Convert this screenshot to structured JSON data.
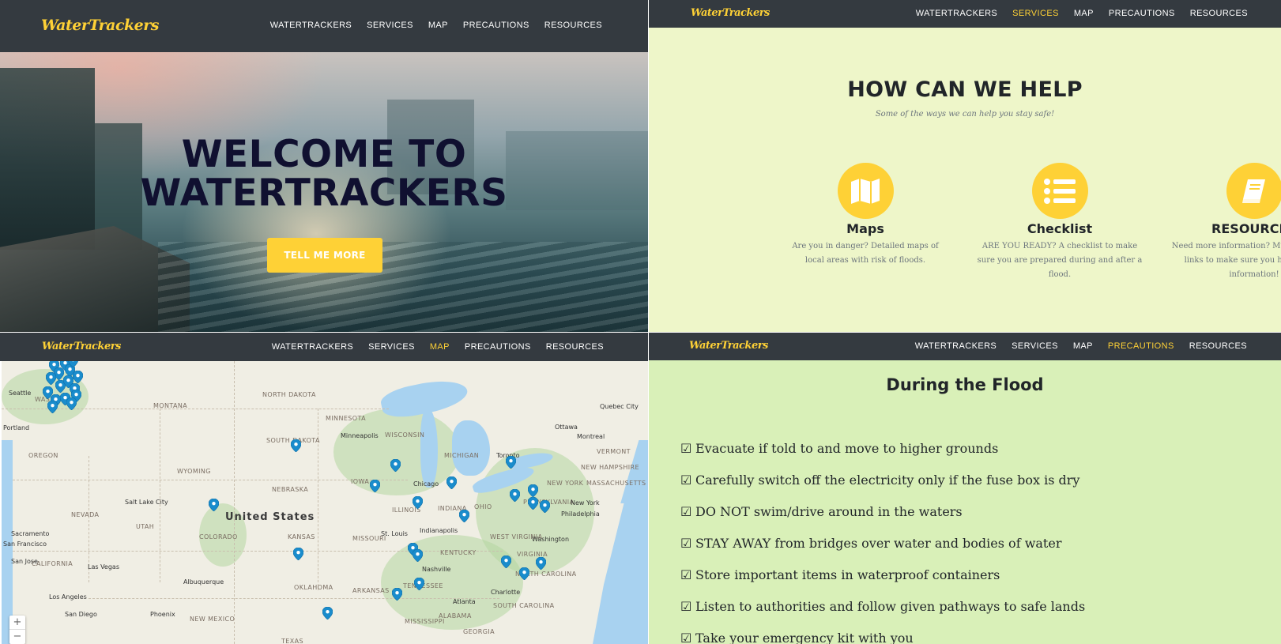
{
  "brand": "WaterTrackers",
  "nav_links": [
    "WATERTRACKERS",
    "SERVICES",
    "MAP",
    "PRECAUTIONS",
    "RESOURCES"
  ],
  "accent_color": "#fed136",
  "nav_color": "#343a40",
  "hero": {
    "title_line1": "WELCOME TO",
    "title_line2": "WATERTRACKERS",
    "button": "TELL ME MORE"
  },
  "services": {
    "active_nav": "SERVICES",
    "title": "HOW CAN WE HELP",
    "subtitle": "Some of the ways we can help you stay safe!",
    "items": [
      {
        "icon": "map-icon",
        "title": "Maps",
        "text": "Are you in danger? Detailed maps of local areas with risk of floods."
      },
      {
        "icon": "list-icon",
        "title": "Checklist",
        "text": "ARE YOU READY? A checklist to make sure you are prepared during and after a flood."
      },
      {
        "icon": "book-icon",
        "title": "RESOURCES",
        "text": "Need more information? Multiple helpful links to make sure you have all the information!"
      }
    ]
  },
  "map": {
    "active_nav": "MAP",
    "country": "United States",
    "zoom_in": "+",
    "zoom_out": "−",
    "states": [
      "NORTH DAKOTA",
      "MONTANA",
      "MINNESOTA",
      "SOUTH DAKOTA",
      "WISCONSIN",
      "MICHIGAN",
      "OREGON",
      "WYOMING",
      "IOWA",
      "NEBRASKA",
      "NEVADA",
      "UTAH",
      "COLORADO",
      "ILLINOIS",
      "INDIANA",
      "OHIO",
      "KANSAS",
      "MISSOURI",
      "KENTUCKY",
      "CALIFORNIA",
      "OKLAHOMA",
      "ARKANSAS",
      "TENNESSEE",
      "VIRGINIA",
      "WEST VIRGINIA",
      "NORTH CAROLINA",
      "SOUTH CAROLINA",
      "NEW MEXICO",
      "MISSISSIPPI",
      "ALABAMA",
      "GEORGIA",
      "TEXAS",
      "NEW YORK",
      "VERMONT",
      "NEW HAMPSHIRE",
      "MASSACHUSETTS",
      "PENNSYLVANIA",
      "WASH"
    ],
    "cities": [
      "Seattle",
      "Portland",
      "Minneapolis",
      "Chicago",
      "Toronto",
      "Ottawa",
      "Montreal",
      "Quebec City",
      "Salt Lake City",
      "Sacramento",
      "San Francisco",
      "San Jose",
      "Las Vegas",
      "Los Angeles",
      "San Diego",
      "Phoenix",
      "Albuquerque",
      "St. Louis",
      "Indianapolis",
      "Nashville",
      "Washington",
      "Charlotte",
      "Atlanta",
      "New York",
      "Philadelphia"
    ]
  },
  "precautions": {
    "active_nav": "PRECAUTIONS",
    "title": "During the Flood",
    "items": [
      "Evacuate if told to and move to higher grounds",
      "Carefully switch off the electricity only if the fuse box is dry",
      "DO NOT swim/drive around in the waters",
      "STAY AWAY from bridges over water and bodies of water",
      "Store important items in waterproof containers",
      "Listen to authorities and follow given pathways to safe lands",
      "Take your emergency kit with you"
    ]
  }
}
